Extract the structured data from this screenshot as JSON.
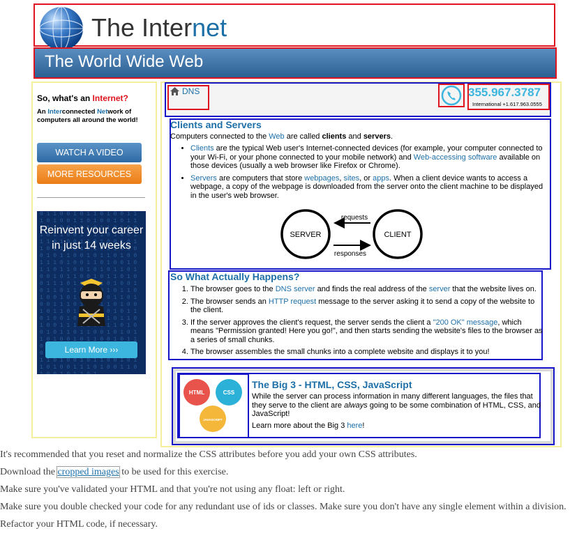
{
  "header": {
    "logo_text_a": "The Inter",
    "logo_text_b": "net",
    "banner_title": "The World Wide Web"
  },
  "sidebar": {
    "question_a": "So, what's an ",
    "question_b": "Internet?",
    "def": [
      "An ",
      "Inter",
      "connected ",
      "Net",
      "work of computers all around the world!"
    ],
    "watch_label": "WATCH A VIDEO",
    "more_label": "MORE RESOURCES",
    "ad": {
      "text": "Reinvent your career in just 14 weeks",
      "button": "Learn More ›››"
    }
  },
  "breadcrumb": {
    "label": "DNS"
  },
  "contact": {
    "phone": "355.967.3787",
    "intl": "International +1.617.963.0555"
  },
  "clients_servers": {
    "title": "Clients and Servers",
    "intro": [
      "Computers connected to the ",
      "Web",
      " are called ",
      "clients",
      " and ",
      "servers",
      "."
    ],
    "item1": [
      "Clients",
      " are the typical Web user's Internet-connected devices (for example, your computer connected to your Wi-Fi, or your phone connected to your mobile network) and ",
      "Web-accessing software",
      " available on those devices (usually a web browser like Firefox or Chrome)."
    ],
    "item2": [
      "Servers",
      " are computers that store ",
      "webpages",
      ", ",
      "sites",
      ", or ",
      "apps",
      ". When a client device wants to access a webpage, a copy of the webpage is downloaded from the server onto the client machine to be displayed in the user's web browser."
    ],
    "diagram": {
      "server": "SERVER",
      "client": "CLIENT",
      "requests": "requests",
      "responses": "responses"
    }
  },
  "what_happens": {
    "title": "So What Actually Happens?",
    "s1": [
      "The browser goes to the ",
      "DNS server",
      " and finds the real address of the ",
      "server",
      " that the website lives on."
    ],
    "s2": [
      "The browser sends an ",
      "HTTP request",
      " message to the server asking it to send a copy of the website to the client."
    ],
    "s3": [
      "If the server approves the client's request, the server sends the client a ",
      "\"200 OK\" message",
      ", which means \"Permission granted! Here you go!\", and then starts sending the website's files to the browser as a series of small chunks."
    ],
    "s4": "The browser assembles the small chunks into a complete website and displays it to you!"
  },
  "big3": {
    "title": "The Big 3 - HTML, CSS, JavaScript",
    "para": [
      "While the server can process information in many different languages, the files that they serve to the client are ",
      "always",
      " going to be some combination of HTML, CSS, and JavaScript!"
    ],
    "more": [
      "Learn more about the Big 3 ",
      "here",
      "!"
    ],
    "badges": [
      "HTML",
      "CSS",
      "JAVASCRIPT"
    ]
  },
  "instructions": {
    "l1": "It's recommended that you reset and normalize the CSS attributes before you add your own CSS attributes.",
    "l2": [
      "Download the ",
      "cropped images",
      " to be used for this exercise."
    ],
    "l3": "Make sure you've validated your HTML and that you're not using any float: left or right.",
    "l4": "Make sure you double checked your code for any redundant use of ids or classes. Make sure you don't have any single element within a division.",
    "l5": "Refactor your HTML code, if necessary."
  },
  "colors": {
    "red": "#e0141e",
    "blue_outline": "#1616c8",
    "yellow_outline": "#f5ef9c",
    "link": "#1d6fa8",
    "cyan": "#3cb6de"
  }
}
